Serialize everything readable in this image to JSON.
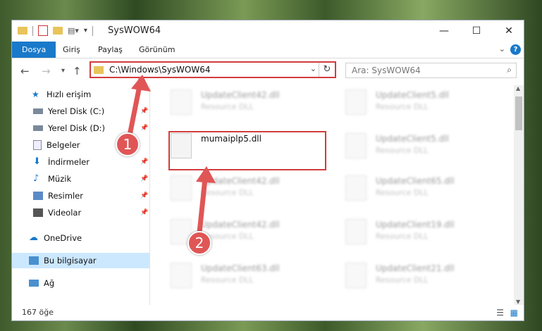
{
  "window": {
    "title": "SysWOW64"
  },
  "ribbon": {
    "tabs": [
      "Dosya",
      "Giriş",
      "Paylaş",
      "Görünüm"
    ],
    "active": "Dosya",
    "help": "?"
  },
  "address": {
    "path": "C:\\Windows\\SysWOW64"
  },
  "search": {
    "placeholder": "Ara: SysWOW64"
  },
  "sidebar": {
    "quick_access": "Hızlı erişim",
    "items": [
      "Yerel Disk (C:)",
      "Yerel Disk (D:)",
      "Belgeler",
      "İndirmeler",
      "Müzik",
      "Resimler",
      "Videolar"
    ],
    "onedrive": "OneDrive",
    "this_pc": "Bu bilgisayar",
    "network": "Ağ"
  },
  "files": {
    "highlighted": {
      "name": "mumaiplp5.dll"
    },
    "blurred": [
      {
        "name": "UpdateClient42.dll",
        "type": "Resource DLL"
      },
      {
        "name": "UpdateClient5.dll",
        "type": "Resource DLL"
      },
      {
        "name": "UpdateClient5.dll",
        "type": "Resource DLL"
      },
      {
        "name": "UpdateClient42.dll",
        "type": "Resource DLL"
      },
      {
        "name": "UpdateClient65.dll",
        "type": "Resource DLL"
      },
      {
        "name": "UpdateClient42.dll",
        "type": "Resource DLL"
      },
      {
        "name": "UpdateClient19.dll",
        "type": "Resource DLL"
      },
      {
        "name": "UpdateClient63.dll",
        "type": "Resource DLL"
      },
      {
        "name": "UpdateClient21.dll",
        "type": "Resource DLL"
      }
    ]
  },
  "status": {
    "count": "167 öğe"
  },
  "markers": {
    "one": "1",
    "two": "2"
  },
  "colors": {
    "accent": "#1979ca",
    "highlight": "#d23c3c"
  }
}
